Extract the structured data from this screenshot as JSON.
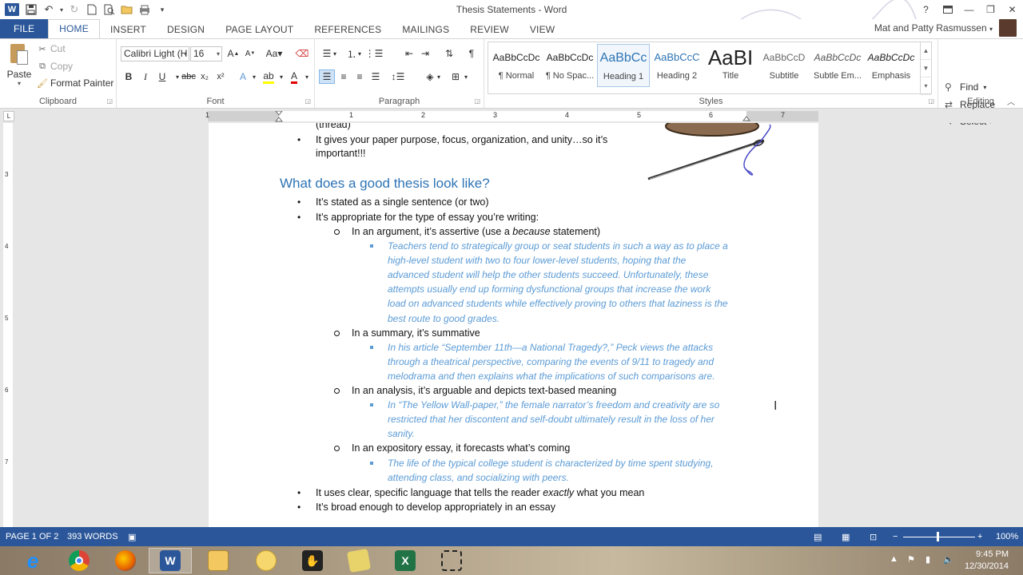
{
  "window": {
    "title": "Thesis Statements - Word",
    "user": "Mat and Patty Rasmussen"
  },
  "tabs": [
    "FILE",
    "HOME",
    "INSERT",
    "DESIGN",
    "PAGE LAYOUT",
    "REFERENCES",
    "MAILINGS",
    "REVIEW",
    "VIEW"
  ],
  "active_tab": "HOME",
  "ribbon": {
    "clipboard": {
      "label": "Clipboard",
      "paste": "Paste",
      "cut": "Cut",
      "copy": "Copy",
      "format_painter": "Format Painter"
    },
    "font": {
      "label": "Font",
      "family": "Calibri Light (H",
      "size": "16"
    },
    "paragraph": {
      "label": "Paragraph"
    },
    "styles": {
      "label": "Styles",
      "items": [
        {
          "preview": "AaBbCcDc",
          "name": "¶ Normal"
        },
        {
          "preview": "AaBbCcDc",
          "name": "¶ No Spac..."
        },
        {
          "preview": "AaBbCc",
          "name": "Heading 1"
        },
        {
          "preview": "AaBbCcC",
          "name": "Heading 2"
        },
        {
          "preview": "AaBI",
          "name": "Title"
        },
        {
          "preview": "AaBbCcD",
          "name": "Subtitle"
        },
        {
          "preview": "AaBbCcDc",
          "name": "Subtle Em..."
        },
        {
          "preview": "AaBbCcDc",
          "name": "Emphasis"
        }
      ]
    },
    "editing": {
      "label": "Editing",
      "find": "Find",
      "replace": "Replace",
      "select": "Select"
    }
  },
  "ruler": {
    "numbers": [
      "1",
      "1",
      "2",
      "3",
      "4",
      "5",
      "6",
      "7"
    ],
    "vertical_numbers": [
      "3",
      "4",
      "5",
      "6",
      "7"
    ]
  },
  "document": {
    "top_partial": "(thread)",
    "intro_bullet_l1": "It gives your paper purpose, focus, organization, and unity…so it’s",
    "intro_bullet_l2": "important!!!",
    "heading": "What does a good thesis look like?",
    "b1": "It’s stated as a single sentence (or two)",
    "b2": "It’s appropriate for the type of essay you’re writing:",
    "argument_pre": "In an argument, it’s assertive (use a ",
    "argument_em": "because",
    "argument_post": " statement)",
    "argument_example": [
      "Teachers tend to strategically group or seat students in such a way as to place a",
      "high-level student with two to four lower-level students, hoping that the",
      "advanced student will help the other students succeed.  Unfortunately, these",
      "attempts usually end up forming dysfunctional groups that increase the work",
      "load on advanced students while effectively proving to others that laziness is the",
      "best route to good grades."
    ],
    "summary": "In a summary, it’s summative",
    "summary_example": [
      "In his article “September 11th—a National Tragedy?,” Peck views the attacks",
      "through a theatrical perspective, comparing the events of 9/11 to tragedy and",
      "melodrama and then explains what the implications of such comparisons are."
    ],
    "analysis": "In an analysis, it’s arguable and depicts text-based meaning",
    "analysis_example": [
      "In “The Yellow Wall-paper,” the female narrator’s freedom and creativity are so",
      "restricted that her discontent and self-doubt ultimately result in the loss of her",
      "sanity."
    ],
    "expository": "In an expository essay, it forecasts what’s coming",
    "expository_example": [
      "The life of the typical college student is characterized by time spent studying,",
      "attending class, and socializing with peers."
    ],
    "b3_pre": "It uses clear, specific language that tells the reader ",
    "b3_em": "exactly",
    "b3_post": " what you mean",
    "b4": "It’s broad enough to develop appropriately in an essay"
  },
  "status": {
    "page": "PAGE 1 OF 2",
    "words": "393 WORDS",
    "zoom": "100%"
  },
  "taskbar": {
    "time": "9:45 PM",
    "date": "12/30/2014",
    "apps": [
      "internet-explorer",
      "chrome",
      "firefox",
      "word",
      "file-explorer",
      "app-yellow",
      "app-dark",
      "app-folder",
      "excel",
      "snipping-tool"
    ]
  },
  "colors": {
    "word_blue": "#2b579a",
    "heading_blue": "#2e74b5",
    "example_blue": "#5b9bd5"
  }
}
